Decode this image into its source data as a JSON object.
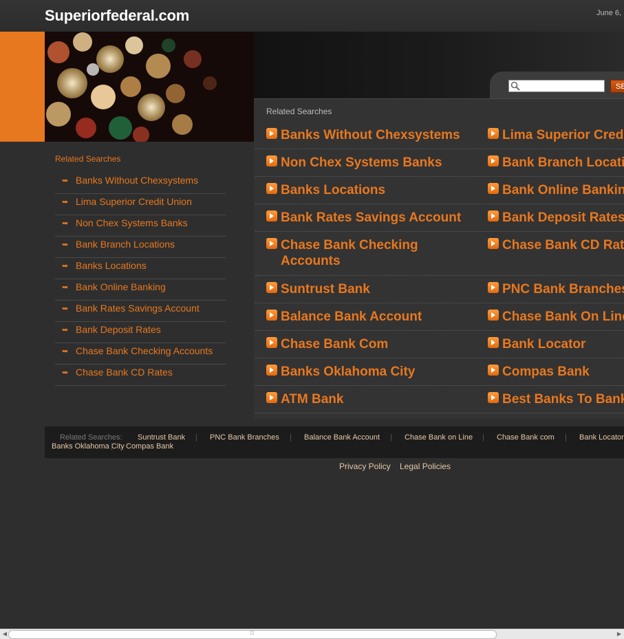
{
  "header": {
    "site_title": "Superiorfederal.com",
    "date": "June 6,"
  },
  "search": {
    "placeholder": "",
    "button_label": "SEARCH",
    "icon": "search-icon"
  },
  "sidebar": {
    "heading": "Related Searches",
    "items": [
      {
        "label": "Banks Without Chexsystems"
      },
      {
        "label": "Lima Superior Credit Union"
      },
      {
        "label": "Non Chex Systems Banks"
      },
      {
        "label": "Bank Branch Locations"
      },
      {
        "label": "Banks Locations"
      },
      {
        "label": "Bank Online Banking"
      },
      {
        "label": "Bank Rates Savings Account"
      },
      {
        "label": "Bank Deposit Rates"
      },
      {
        "label": "Chase Bank Checking Accounts"
      },
      {
        "label": "Chase Bank CD Rates"
      }
    ]
  },
  "main": {
    "heading": "Related Searches",
    "rows": [
      {
        "left": "Banks Without Chexsystems",
        "right": "Lima Superior Credit Union"
      },
      {
        "left": "Non Chex Systems Banks",
        "right": "Bank Branch Locations"
      },
      {
        "left": "Banks Locations",
        "right": "Bank Online Banking"
      },
      {
        "left": "Bank Rates Savings Account",
        "right": "Bank Deposit Rates"
      },
      {
        "left": "Chase Bank Checking Accounts",
        "right": "Chase Bank CD Rates"
      },
      {
        "left": "Suntrust Bank",
        "right": "PNC Bank Branches"
      },
      {
        "left": "Balance Bank Account",
        "right": "Chase Bank On Line"
      },
      {
        "left": "Chase Bank Com",
        "right": "Bank Locator"
      },
      {
        "left": "Banks Oklahoma City",
        "right": "Compas Bank"
      },
      {
        "left": "ATM Bank",
        "right": "Best Banks To Bank With"
      }
    ]
  },
  "footer": {
    "label": "Related Searches:",
    "links": [
      "Suntrust Bank",
      "PNC Bank Branches",
      "Balance Bank Account",
      "Chase Bank on Line",
      "Chase Bank com",
      "Bank Locator",
      "Banks Oklahoma City",
      "Compas Bank"
    ],
    "separator": "|",
    "bottom_links": [
      "Privacy Policy",
      "Legal Policies"
    ]
  },
  "colors": {
    "accent": "#e8781f",
    "background": "#2e2e2e",
    "footer_background": "#1c1c1c"
  }
}
